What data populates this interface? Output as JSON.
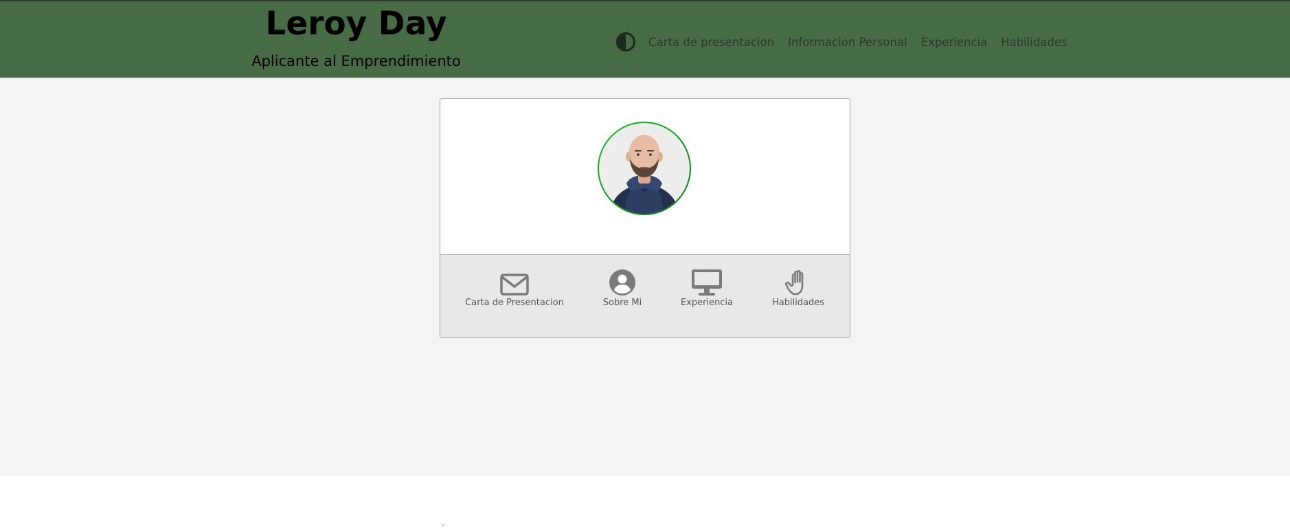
{
  "header": {
    "name": "Leroy Day",
    "subtitle": "Aplicante al Emprendimiento",
    "theme_icon": "contrast-icon",
    "nav": [
      {
        "label": "Carta de presentacion"
      },
      {
        "label": "Informacion Personal"
      },
      {
        "label": "Experiencia"
      },
      {
        "label": "Habilidades"
      }
    ]
  },
  "card": {
    "avatar_icon": "profile-photo",
    "items": [
      {
        "label": "Carta de Presentacion",
        "icon": "envelope-icon"
      },
      {
        "label": "Sobre Mi",
        "icon": "user-circle-icon"
      },
      {
        "label": "Experiencia",
        "icon": "desktop-icon"
      },
      {
        "label": "Habilidades",
        "icon": "hand-icon"
      }
    ]
  },
  "colors": {
    "header_bg": "#466b45",
    "nav_text": "#2a3a2a",
    "avatar_ring": "#10a41a",
    "card_icons": "#7a7a7a"
  },
  "footer": {
    "stray_char": "´"
  }
}
